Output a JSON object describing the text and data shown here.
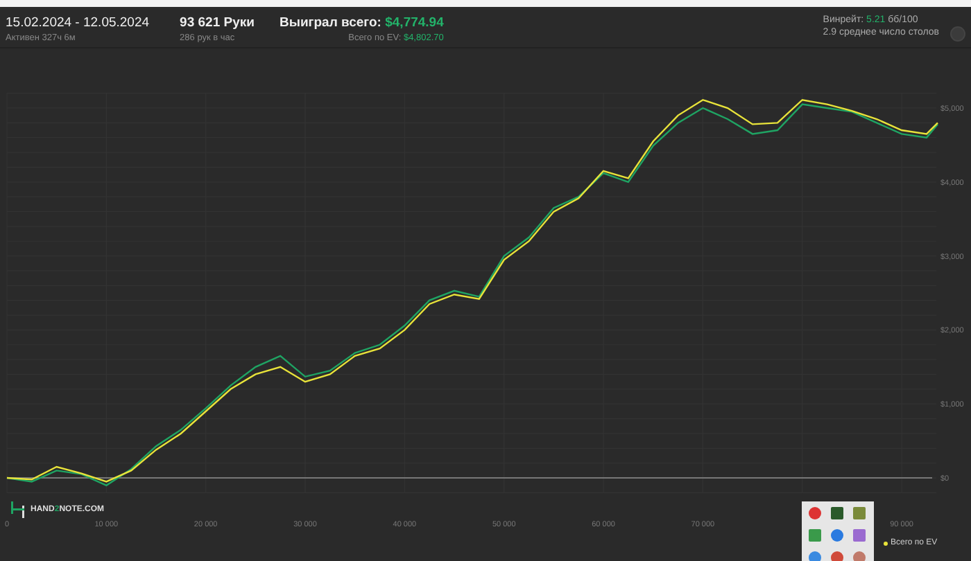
{
  "header": {
    "date_range": "15.02.2024 - 12.05.2024",
    "active": "Активен 327ч 6м",
    "hands": "93 621 Руки",
    "hands_per_hour": "286 рук в час",
    "won_label": "Выиграл всего:",
    "won_value": "$4,774.94",
    "ev_label": "Всего по EV:",
    "ev_value": "$4,802.70",
    "winrate_label": "Винрейт:",
    "winrate_value": "5.21",
    "winrate_unit": "бб/100",
    "tables": "2.9 среднее число столов"
  },
  "chart": {
    "chart_data": {
      "type": "line",
      "grid": true,
      "x": [
        0,
        2500,
        5000,
        7500,
        10000,
        12500,
        15000,
        17500,
        20000,
        22500,
        25000,
        27500,
        30000,
        32500,
        35000,
        37500,
        40000,
        42500,
        45000,
        47500,
        50000,
        52500,
        55000,
        57500,
        60000,
        62500,
        65000,
        67500,
        70000,
        72500,
        75000,
        77500,
        80000,
        82500,
        85000,
        87500,
        90000,
        92500,
        93621
      ],
      "series": [
        {
          "color": "#1fa463",
          "values": [
            0,
            -50,
            100,
            50,
            -100,
            120,
            430,
            650,
            940,
            1250,
            1500,
            1650,
            1370,
            1450,
            1690,
            1800,
            2060,
            2400,
            2530,
            2450,
            3000,
            3250,
            3650,
            3800,
            4120,
            4000,
            4490,
            4800,
            5000,
            4850,
            4650,
            4700,
            5050,
            5000,
            4950,
            4800,
            4650,
            4600,
            4780
          ]
        },
        {
          "name": "Всего по EV",
          "color": "#e8e33a",
          "values": [
            0,
            -20,
            150,
            60,
            -50,
            100,
            380,
            600,
            900,
            1200,
            1400,
            1500,
            1300,
            1400,
            1650,
            1750,
            2000,
            2350,
            2480,
            2420,
            2950,
            3200,
            3600,
            3780,
            4150,
            4050,
            4550,
            4900,
            5110,
            5000,
            4780,
            4800,
            5110,
            5050,
            4960,
            4850,
            4700,
            4650,
            4800
          ]
        }
      ],
      "xlim": [
        0,
        93621
      ],
      "ylim": [
        -200,
        5200
      ],
      "xticks": [
        {
          "value": 0,
          "label": "0"
        },
        {
          "value": 10000,
          "label": "10 000"
        },
        {
          "value": 20000,
          "label": "20 000"
        },
        {
          "value": 30000,
          "label": "30 000"
        },
        {
          "value": 40000,
          "label": "40 000"
        },
        {
          "value": 50000,
          "label": "50 000"
        },
        {
          "value": 60000,
          "label": "60 000"
        },
        {
          "value": 70000,
          "label": "70 000"
        },
        {
          "value": 90000,
          "label": "90 000"
        }
      ],
      "yticks": [
        {
          "value": 0,
          "label": "$0"
        },
        {
          "value": 1000,
          "label": "$1,000"
        },
        {
          "value": 2000,
          "label": "$2,000"
        },
        {
          "value": 3000,
          "label": "$3,000"
        },
        {
          "value": 4000,
          "label": "$4,000"
        },
        {
          "value": 5000,
          "label": "$5,000"
        }
      ]
    },
    "logo": [
      "HAND",
      "2",
      "NOTE.COM"
    ]
  }
}
